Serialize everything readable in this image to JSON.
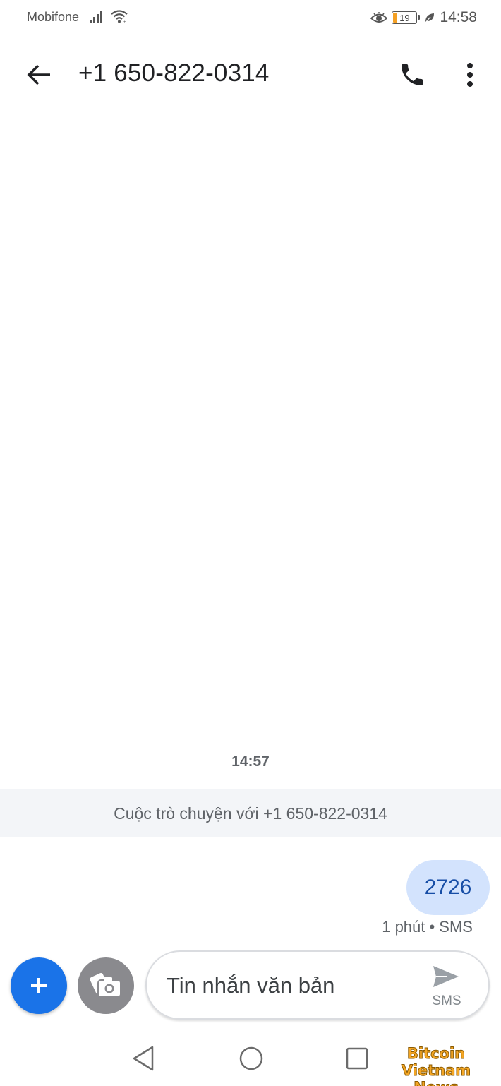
{
  "status_bar": {
    "carrier": "Mobifone",
    "battery_level": "19",
    "time": "14:58"
  },
  "app_bar": {
    "title": "+1 650-822-0314"
  },
  "conversation": {
    "timestamp": "14:57",
    "banner": "Cuộc trò chuyện với +1 650-822-0314",
    "messages": [
      {
        "text": "2726",
        "meta": "1 phút • SMS",
        "direction": "outgoing"
      }
    ]
  },
  "compose": {
    "placeholder": "Tin nhắn văn bản",
    "send_label": "SMS"
  },
  "watermark": {
    "line1": "Bitcoin Vietnam",
    "line2": "News"
  },
  "colors": {
    "accent": "#1a73e8",
    "bubble": "#d3e3fd",
    "bubble_text": "#174ea6",
    "banner_bg": "#f3f5f8",
    "watermark": "#f5a623"
  },
  "icons": [
    "signal-icon",
    "wifi-icon",
    "eye-icon",
    "battery-icon",
    "leaf-icon",
    "back-arrow-icon",
    "phone-icon",
    "more-vert-icon",
    "plus-icon",
    "camera-icon",
    "send-icon",
    "nav-back-icon",
    "nav-home-icon",
    "nav-recents-icon"
  ]
}
